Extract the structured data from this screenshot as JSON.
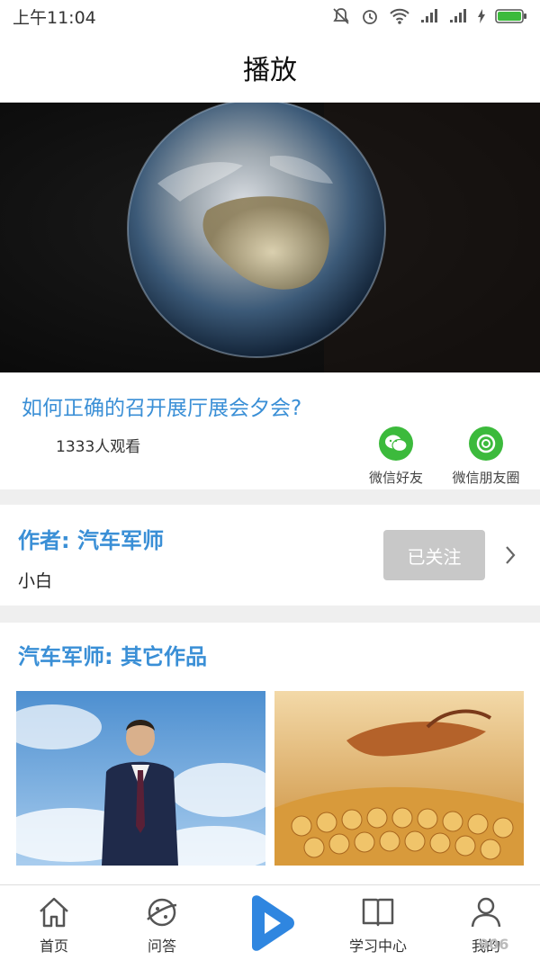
{
  "status_bar": {
    "time": "上午11:04"
  },
  "header": {
    "title": "播放"
  },
  "video": {
    "title": "如何正确的召开展厅展会夕会?",
    "views": "1333人观看"
  },
  "share": {
    "wechat_friend": "微信好友",
    "wechat_moments": "微信朋友圈"
  },
  "author": {
    "name": "作者: 汽车军师",
    "description": "小白",
    "follow_label": "已关注"
  },
  "works": {
    "title": "汽车军师: 其它作品"
  },
  "tab_bar": {
    "items": [
      {
        "label": "首页",
        "icon": "home-icon"
      },
      {
        "label": "问答",
        "icon": "planet-icon"
      },
      {
        "label": "",
        "icon": "play-icon"
      },
      {
        "label": "学习中心",
        "icon": "book-icon"
      },
      {
        "label": "我的",
        "icon": "user-icon"
      }
    ]
  },
  "watermark": "906",
  "colors": {
    "accent": "#3a8fd6",
    "wechat_green": "#3cba3c",
    "followed_button": "#c8c8c8",
    "play_blue": "#2f86e0"
  }
}
